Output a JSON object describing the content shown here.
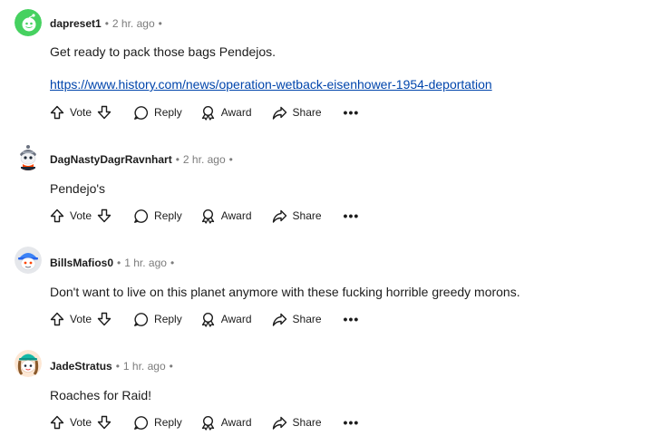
{
  "actions": {
    "vote_label": "Vote",
    "reply_label": "Reply",
    "award_label": "Award",
    "share_label": "Share",
    "more_label": "•••"
  },
  "comments": [
    {
      "author": "dapreset1",
      "time": "2 hr. ago",
      "text": "Get ready to pack those bags Pendejos.",
      "link": "https://www.history.com/news/operation-wetback-eisenhower-1954-deportation",
      "avatar": "green-snoo-icon"
    },
    {
      "author": "DagNastyDagrRavnhart",
      "time": "2 hr. ago",
      "text": "Pendejo's",
      "avatar": "snoo-helmet-icon"
    },
    {
      "author": "BillsMafios0",
      "time": "1 hr. ago",
      "text": "Don't want to live on this planet anymore with these fucking horrible greedy morons.",
      "avatar": "snoo-blue-hat-icon"
    },
    {
      "author": "JadeStratus",
      "time": "1 hr. ago",
      "text": "Roaches for Raid!",
      "avatar": "snoo-teal-hat-icon"
    }
  ],
  "colors": {
    "text": "#1c1c1c",
    "meta": "#7c7c7c",
    "link": "#0045ac",
    "avatar_green": "#46d160"
  }
}
